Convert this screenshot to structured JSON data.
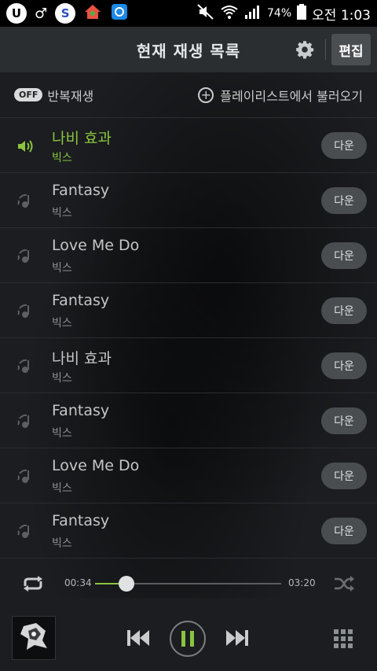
{
  "status_bar": {
    "battery": "74%",
    "time": "오전 1:03"
  },
  "header": {
    "title": "현재 재생 목록",
    "edit_label": "편집"
  },
  "toolbar": {
    "repeat_state": "OFF",
    "repeat_label": "반복재생",
    "load_playlist_label": "플레이리스트에서 불러오기"
  },
  "tracks": [
    {
      "title": "나비 효과",
      "artist": "빅스",
      "download_label": "다운",
      "current": true
    },
    {
      "title": "Fantasy",
      "artist": "빅스",
      "download_label": "다운"
    },
    {
      "title": "Love Me Do",
      "artist": "빅스",
      "download_label": "다운"
    },
    {
      "title": "Fantasy",
      "artist": "빅스",
      "download_label": "다운"
    },
    {
      "title": "나비 효과",
      "artist": "빅스",
      "download_label": "다운"
    },
    {
      "title": "Fantasy",
      "artist": "빅스",
      "download_label": "다운"
    },
    {
      "title": "Love Me Do",
      "artist": "빅스",
      "download_label": "다운"
    },
    {
      "title": "Fantasy",
      "artist": "빅스",
      "download_label": "다운"
    }
  ],
  "player": {
    "current_time": "00:34",
    "total_time": "03:20",
    "progress": 0.17,
    "album_logo_text": "VIXX"
  },
  "colors": {
    "accent": "#8ac43f",
    "background": "#1b1d20",
    "header": "#2b2e31"
  }
}
